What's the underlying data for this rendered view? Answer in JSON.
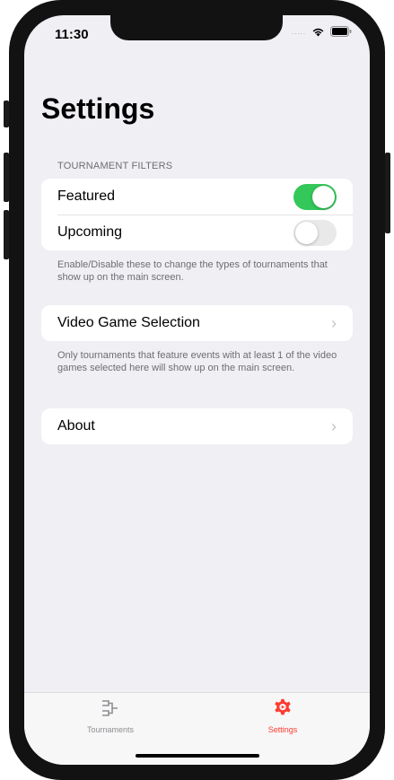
{
  "status_bar": {
    "time": "11:30",
    "signal_dots": "....."
  },
  "page": {
    "title": "Settings"
  },
  "tournament_filters": {
    "header": "TOURNAMENT FILTERS",
    "items": [
      {
        "label": "Featured",
        "enabled": true
      },
      {
        "label": "Upcoming",
        "enabled": false
      }
    ],
    "footer": "Enable/Disable these to change the types of tournaments that show up on the main screen."
  },
  "video_game_selection": {
    "label": "Video Game Selection",
    "footer": "Only tournaments that feature events with at least 1 of the video games selected here will show up on the main screen."
  },
  "about": {
    "label": "About"
  },
  "tab_bar": {
    "tabs": [
      {
        "label": "Tournaments",
        "icon": "bracket-icon",
        "active": false
      },
      {
        "label": "Settings",
        "icon": "gear-icon",
        "active": true
      }
    ]
  },
  "colors": {
    "accent": "#34c759",
    "tab_active": "#ff3b30",
    "tab_inactive": "#8e8e93"
  }
}
